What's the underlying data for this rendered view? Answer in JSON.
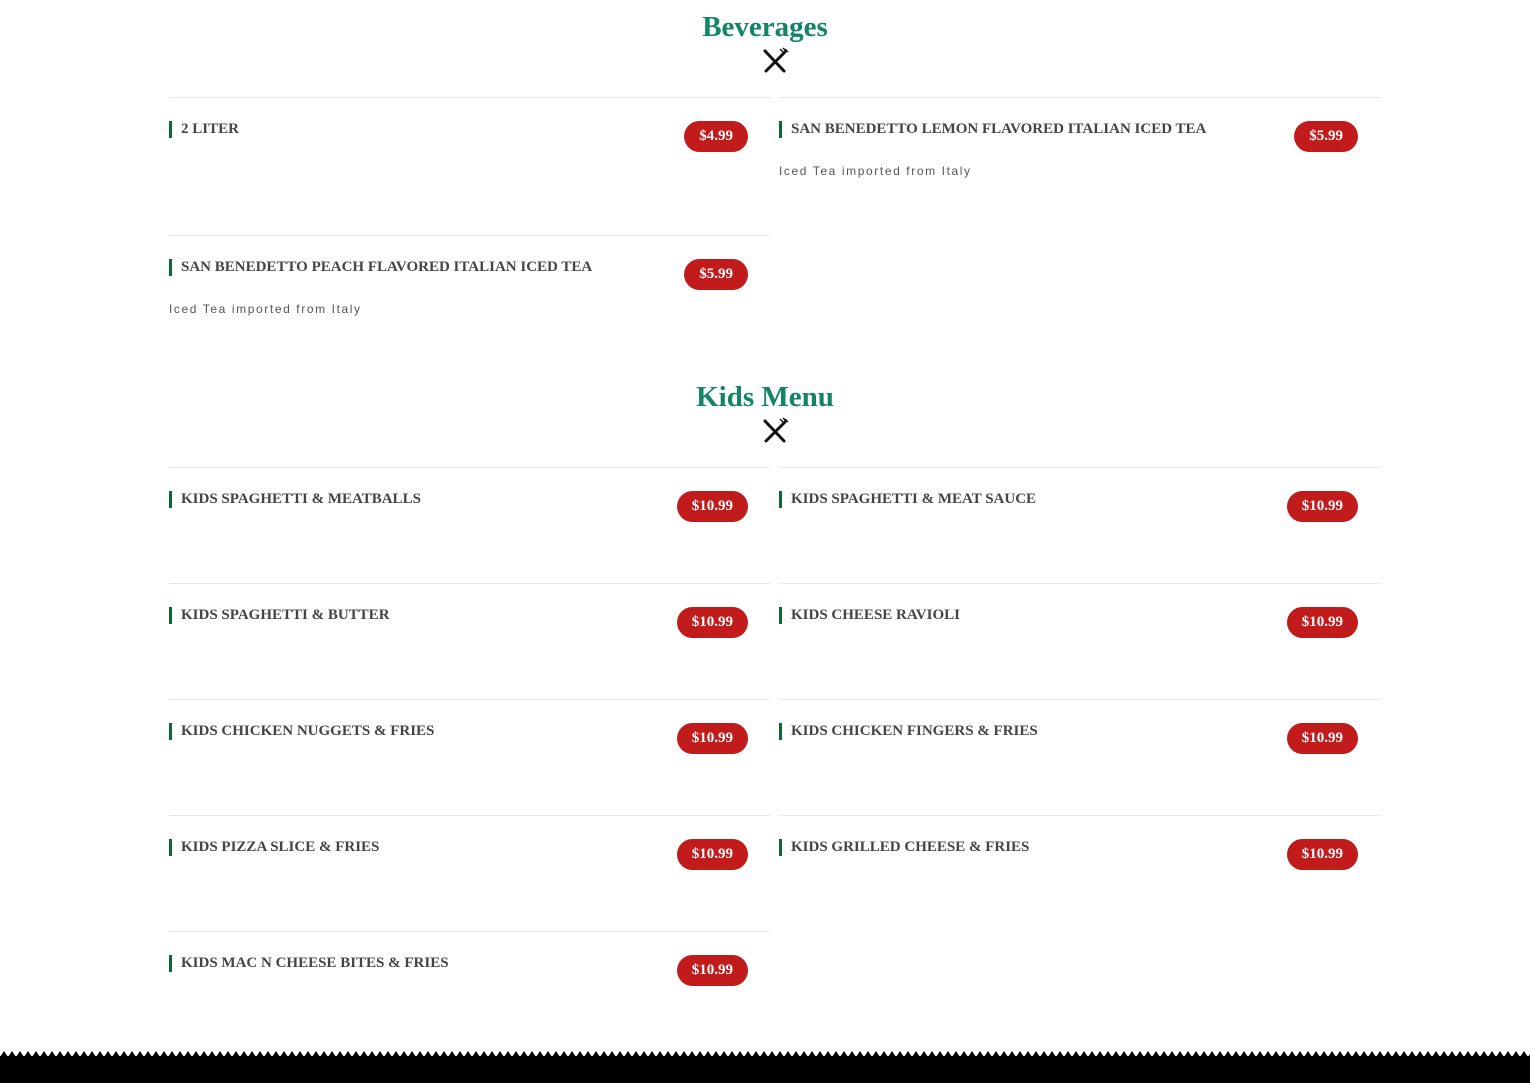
{
  "beverages": {
    "title": "Beverages",
    "icon": "cutlery-icon",
    "items": [
      {
        "name": "2 LITER",
        "price": "$4.99",
        "description": ""
      },
      {
        "name": "SAN BENEDETTO LEMON FLAVORED ITALIAN ICED TEA",
        "price": "$5.99",
        "description": "Iced Tea imported from Italy"
      },
      {
        "name": "SAN BENEDETTO PEACH FLAVORED ITALIAN ICED TEA",
        "price": "$5.99",
        "description": "Iced Tea imported from Italy"
      }
    ]
  },
  "kids_menu": {
    "title": "Kids Menu",
    "icon": "cutlery-icon",
    "items": [
      {
        "name": "KIDS SPAGHETTI & MEATBALLS",
        "price": "$10.99"
      },
      {
        "name": "KIDS SPAGHETTI & MEAT SAUCE",
        "price": "$10.99"
      },
      {
        "name": "KIDS SPAGHETTI & BUTTER",
        "price": "$10.99"
      },
      {
        "name": "KIDS CHEESE RAVIOLI",
        "price": "$10.99"
      },
      {
        "name": "KIDS CHICKEN NUGGETS & FRIES",
        "price": "$10.99"
      },
      {
        "name": "KIDS CHICKEN FINGERS & FRIES",
        "price": "$10.99"
      },
      {
        "name": "KIDS PIZZA SLICE & FRIES",
        "price": "$10.99"
      },
      {
        "name": "KIDS GRILLED CHEESE & FRIES",
        "price": "$10.99"
      },
      {
        "name": "KIDS MAC N CHEESE BITES & FRIES",
        "price": "$10.99"
      }
    ]
  },
  "colors": {
    "section_title": "#138466",
    "price_badge": "#c11b1b",
    "item_accent": "#0a6b2a",
    "item_name": "#444444",
    "footer": "#000000"
  }
}
